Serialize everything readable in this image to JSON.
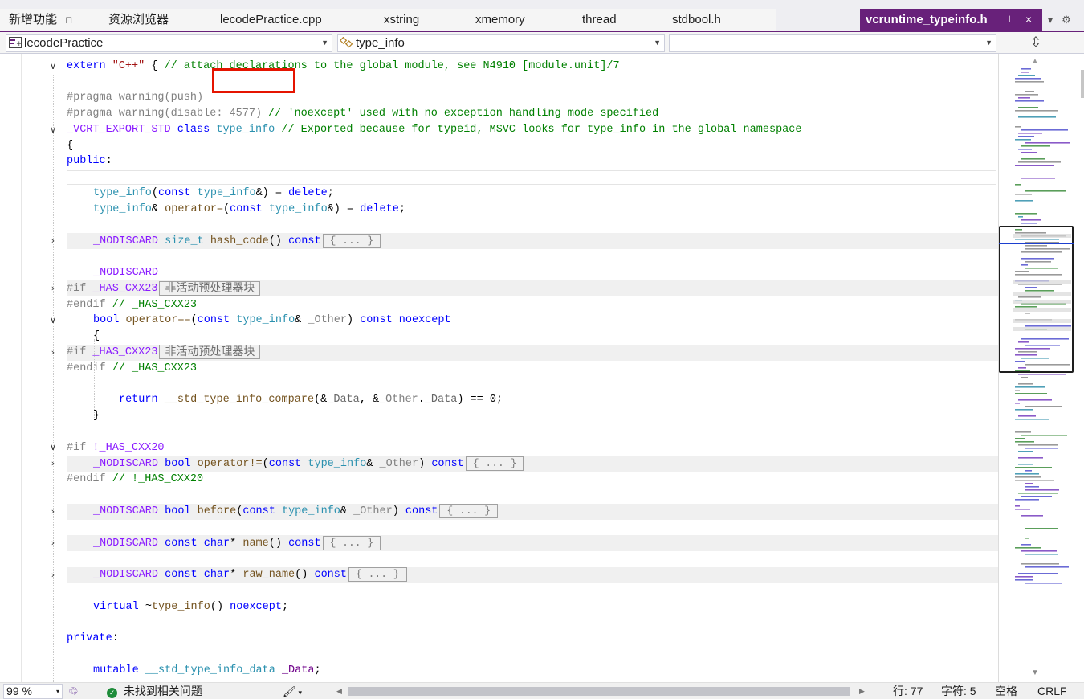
{
  "tabs": {
    "items": [
      {
        "label": "新增功能",
        "pinned": true
      },
      {
        "label": "资源浏览器"
      },
      {
        "label": "lecodePractice.cpp"
      },
      {
        "label": "xstring"
      },
      {
        "label": "xmemory"
      },
      {
        "label": "thread"
      },
      {
        "label": "stdbool.h"
      }
    ],
    "active": {
      "label": "vcruntime_typeinfo.h",
      "pin_icon": "pin-icon",
      "close_icon": "close-icon"
    },
    "pin_glyph": "⊓",
    "active_pin_glyph": "⊥",
    "close_glyph": "×",
    "overflow_glyph": "▾",
    "settings_glyph": "⚙",
    "accent_color": "#68217a"
  },
  "navbar": {
    "project": "lecodePractice",
    "scope": "type_info",
    "member": "",
    "split_glyph": "⇳"
  },
  "code": {
    "l1": {
      "a": "extern ",
      "b": "\"C++\"",
      "c": " { ",
      "d": "// attach declarations to the global module, see N4910 [module.unit]/7"
    },
    "l2": {
      "a": "#pragma warning(push)"
    },
    "l3": {
      "a": "#pragma warning(disable: 4577) ",
      "b": "// 'noexcept' used with no exception handling mode specified"
    },
    "l4": {
      "a": "_VCRT_EXPORT_STD",
      "b": " class ",
      "c": "type_info",
      "d": " // Exported because for typeid, MSVC looks for type_info in the global namespace"
    },
    "l5": {
      "a": "{"
    },
    "l6": {
      "a": "public",
      "b": ":"
    },
    "l7": {
      "a": "type_info",
      "b": "(",
      "c": "const",
      "d": " type_info",
      "e": "&) = ",
      "f": "delete",
      "g": ";"
    },
    "l8": {
      "a": "type_info",
      "b": "& ",
      "c": "operator=",
      "d": "(",
      "e": "const",
      "f": " type_info",
      "g": "&) = ",
      "h": "delete",
      "i": ";"
    },
    "l9": {
      "a": "_NODISCARD",
      "b": " size_t",
      "c": " hash_code",
      "d": "() ",
      "e": "const",
      "f": "{ ... }"
    },
    "l10": {
      "a": "_NODISCARD"
    },
    "l11": {
      "a": "#if ",
      "b": "_HAS_CXX23",
      "c": "非活动预处理器块"
    },
    "l12": {
      "a": "#endif ",
      "b": "// _HAS_CXX23"
    },
    "l13": {
      "a": "bool",
      "b": " operator==",
      "c": "(",
      "d": "const",
      "e": " type_info",
      "f": "& ",
      "g": "_Other",
      "h": ") ",
      "i": "const",
      "j": " noexcept"
    },
    "l14": {
      "a": "{"
    },
    "l15": {
      "a": "#if ",
      "b": "_HAS_CXX23",
      "c": "非活动预处理器块"
    },
    "l16": {
      "a": "#endif ",
      "b": "// _HAS_CXX23"
    },
    "l17": {
      "a": "return",
      "b": " __std_type_info_compare",
      "c": "(&",
      "d": "_Data",
      "e": ", &",
      "f": "_Other",
      "g": ".",
      "h": "_Data",
      "i": ") == 0;"
    },
    "l18": {
      "a": "}"
    },
    "l19": {
      "a": "#if ",
      "b": "!_HAS_CXX20"
    },
    "l20": {
      "a": "_NODISCARD",
      "b": " bool",
      "c": " operator!=",
      "d": "(",
      "e": "const",
      "f": " type_info",
      "g": "& ",
      "h": "_Other",
      "i": ") ",
      "j": "const",
      "k": "{ ... }"
    },
    "l21": {
      "a": "#endif ",
      "b": "// !_HAS_CXX20"
    },
    "l22": {
      "a": "_NODISCARD",
      "b": " bool",
      "c": " before",
      "d": "(",
      "e": "const",
      "f": " type_info",
      "g": "& ",
      "h": "_Other",
      "i": ") ",
      "j": "const",
      "k": "{ ... }"
    },
    "l23": {
      "a": "_NODISCARD",
      "b": " const",
      "c": " char",
      "d": "* ",
      "e": "name",
      "f": "() ",
      "g": "const",
      "h": "{ ... }"
    },
    "l24": {
      "a": "_NODISCARD",
      "b": " const",
      "c": " char",
      "d": "* ",
      "e": "raw_name",
      "f": "() ",
      "g": "const",
      "h": "{ ... }"
    },
    "l25": {
      "a": "virtual",
      "b": " ~",
      "c": "type_info",
      "d": "() ",
      "e": "noexcept",
      "f": ";"
    },
    "l26": {
      "a": "private",
      "b": ":"
    },
    "l27": {
      "a": "mutable",
      "b": " __std_type_info_data",
      "c": " _Data",
      "d": ";"
    }
  },
  "fold_glyphs": {
    "expanded": "∨",
    "collapsed": "›"
  },
  "highlight": {
    "color": "#e51400",
    "target": "type_info"
  },
  "minimap": {
    "up_glyph": "▲",
    "down_glyph": "▼"
  },
  "statusbar": {
    "zoom": "99 %",
    "zoom_dd": "▾",
    "issues_icon": "check-circle-icon",
    "issues_text": "未找到相关问题",
    "ok_glyph": "✓",
    "brush_glyph": "🖌",
    "brush_dd": "▾",
    "left_arrow": "◀",
    "right_arrow": "▶",
    "line": "行: 77",
    "col": "字符: 5",
    "indent": "空格",
    "eol": "CRLF",
    "health_glyph": "♲"
  }
}
